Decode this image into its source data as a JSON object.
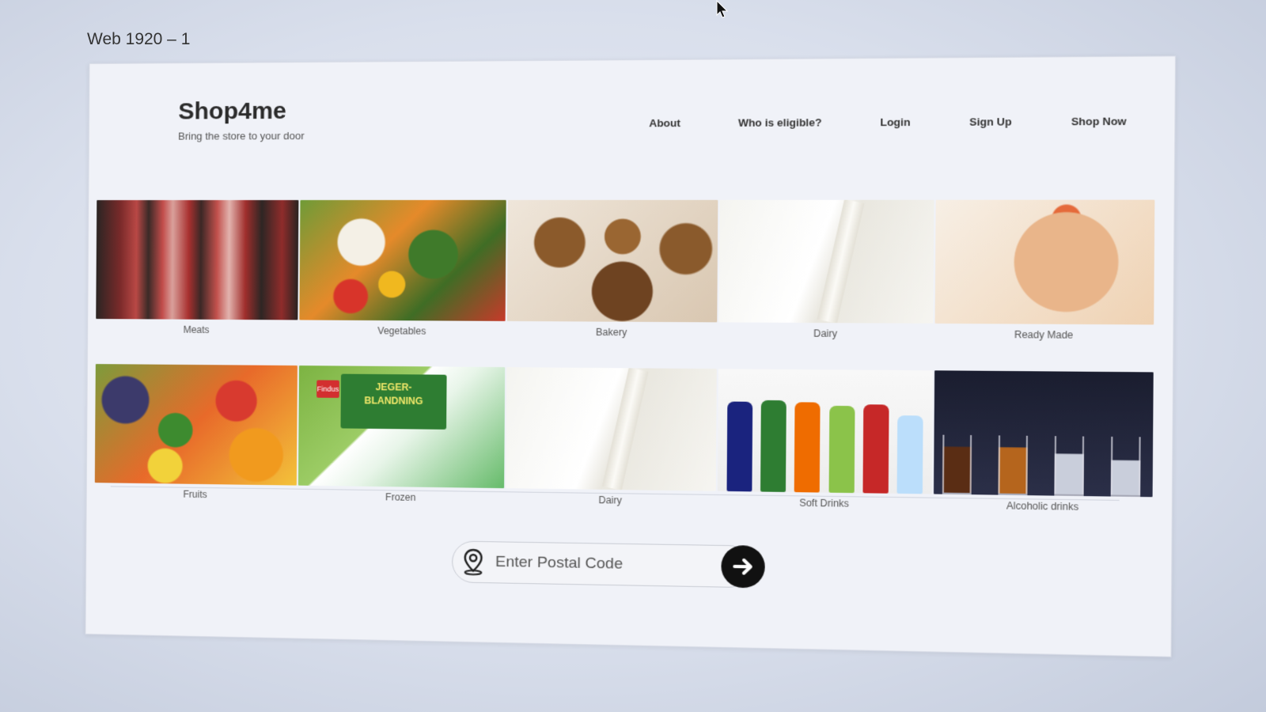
{
  "frame_label": "Web 1920 – 1",
  "brand": {
    "title": "Shop4me",
    "tagline": "Bring the store to your door"
  },
  "nav": [
    "About",
    "Who is eligible?",
    "Login",
    "Sign Up",
    "Shop Now"
  ],
  "categories": {
    "row1": [
      "Meats",
      "Vegetables",
      "Bakery",
      "Dairy",
      "Ready Made"
    ],
    "row2": [
      "Fruits",
      "Frozen",
      "Dairy",
      "Soft Drinks",
      "Alcoholic drinks"
    ]
  },
  "frozen_package": {
    "brand": "Findus",
    "line1": "JEGER-",
    "line2": "BLANDNING"
  },
  "postal": {
    "placeholder": "Enter Postal Code"
  },
  "icons": {
    "location": "location-pin-icon",
    "submit": "arrow-right-icon"
  }
}
